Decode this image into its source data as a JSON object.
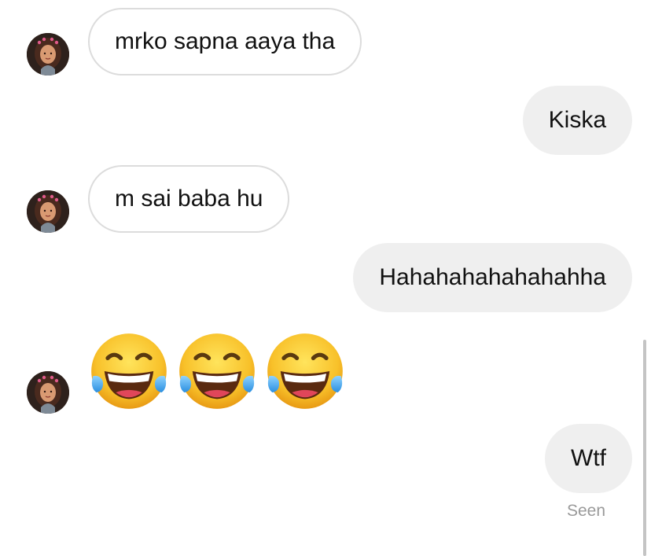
{
  "conversation": {
    "messages": [
      {
        "sender": "them",
        "text": "mrko sapna aaya tha"
      },
      {
        "sender": "me",
        "text": "Kiska"
      },
      {
        "sender": "them",
        "text": "m sai baba hu"
      },
      {
        "sender": "me",
        "text": "Hahahahahahahahha"
      },
      {
        "sender": "them",
        "emoji": "😂😂😂",
        "emoji_names": [
          "face-with-tears-of-joy",
          "face-with-tears-of-joy",
          "face-with-tears-of-joy"
        ]
      },
      {
        "sender": "me",
        "text": "Wtf"
      }
    ],
    "seen_label": "Seen"
  },
  "icons": {
    "avatar": "user-avatar-icon",
    "emoji": "face-with-tears-of-joy-icon"
  },
  "colors": {
    "incoming_bubble_border": "#dcdcdc",
    "outgoing_bubble_bg": "#efefef",
    "seen_text": "#9a9a9a"
  }
}
